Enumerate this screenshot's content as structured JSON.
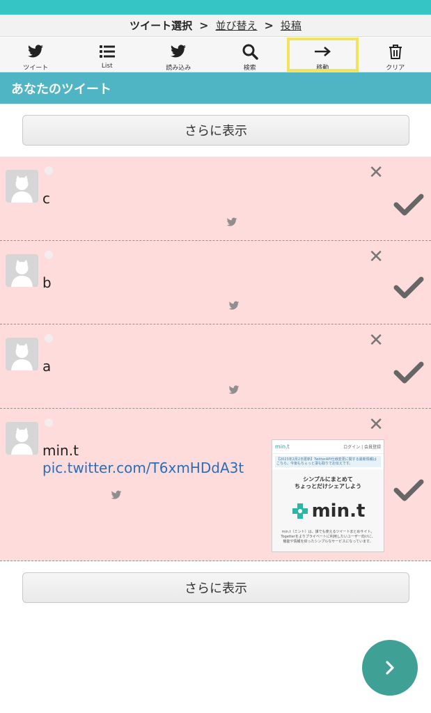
{
  "steps": {
    "current": "ツイート選択",
    "sort": "並び替え",
    "post": "投稿",
    "separator": ">"
  },
  "toolbar": [
    {
      "icon": "twitter-bird-icon",
      "label": "ツイート"
    },
    {
      "icon": "list-icon",
      "label": "List"
    },
    {
      "icon": "twitter-bird-icon",
      "label": "読み込み"
    },
    {
      "icon": "search-icon",
      "label": "検索"
    },
    {
      "icon": "arrow-right-icon",
      "label": "移動",
      "highlighted": true
    },
    {
      "icon": "trash-icon",
      "label": "クリア"
    }
  ],
  "section_title": "あなたのツイート",
  "more_top": "さらに表示",
  "more_bottom": "さらに表示",
  "tweets": [
    {
      "text": "c"
    },
    {
      "text": "b"
    },
    {
      "text": "a"
    },
    {
      "text": "min.t",
      "link": "pic.twitter.com/T6xmHDdA3t",
      "preview": {
        "brand": "min.t",
        "login": "ログイン | 会員登録",
        "notice": "【2023年2月2日更新】TwitterAPI仕様変更に関する最新情報はこちら。今後もちぇっと凄も取りでお伝えです。",
        "tagline_1": "シンプルにまとめて",
        "tagline_2": "ちょっとだけシェアしよう",
        "logo": "min.t",
        "desc_1": "min.t（ミント）は、誰でも使えるツイートまとめサイト。",
        "desc_2": "Togetterをよりプライベートに利用したいユーザー向けに、",
        "desc_3": "機能や情報を絞ったシンプルなサービスになっています。"
      }
    }
  ],
  "colors": {
    "accent": "#35c5c5",
    "section": "#4fb4c4",
    "tweet_bg": "#ffdcdc",
    "link": "#2a6db8",
    "fab": "#3fa196",
    "highlight": "#f3e35a"
  }
}
